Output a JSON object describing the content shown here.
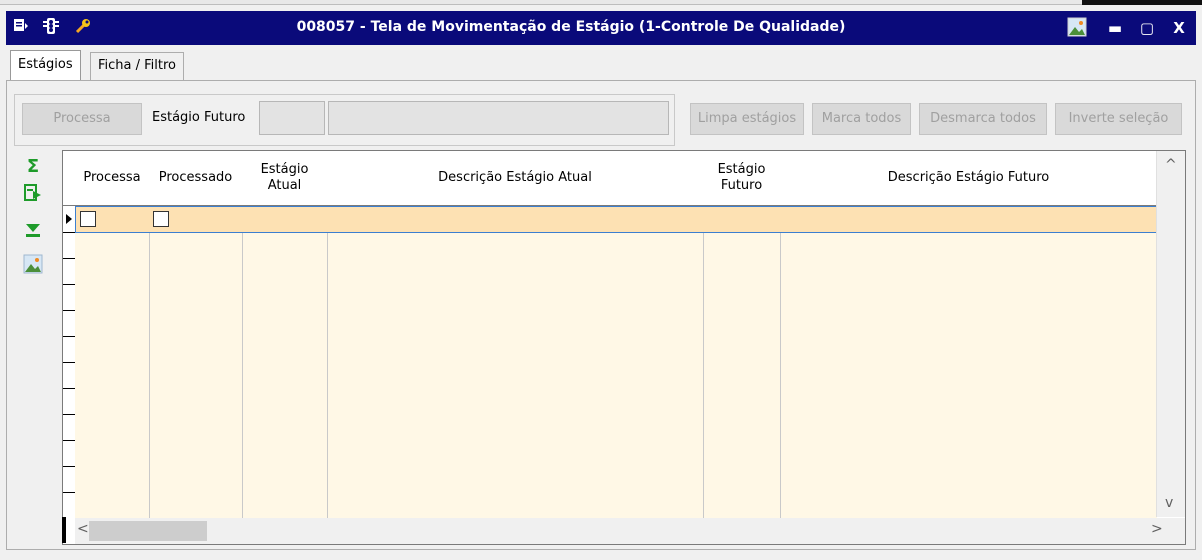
{
  "window": {
    "title": "008057 - Tela de Movimentação de Estágio (1-Controle De Qualidade)",
    "left_icons": [
      "list-icon",
      "traffic-light-icon",
      "wrench-icon"
    ],
    "right_icons": [
      "image-icon",
      "minimize-icon",
      "maximize-icon",
      "close-icon"
    ],
    "minimize_glyph": "▬",
    "maximize_glyph": "▢",
    "close_glyph": "X"
  },
  "tabs": [
    {
      "label": "Estágios",
      "active": true
    },
    {
      "label": "Ficha / Filtro",
      "active": false
    }
  ],
  "toolbar": {
    "processa_label": "Processa",
    "estagio_futuro_label": "Estágio Futuro",
    "estagio_futuro_code": "",
    "estagio_futuro_desc": "",
    "limpa_label": "Limpa estágios",
    "marca_label": "Marca todos",
    "desmarca_label": "Desmarca todos",
    "inverte_label": "Inverte seleção"
  },
  "side_icons": [
    "sum-icon",
    "export-icon",
    "download-icon",
    "image-icon"
  ],
  "grid": {
    "columns": [
      "Processa",
      "Processado",
      "Estágio\nAtual",
      "Descrição Estágio Atual",
      "Estágio\nFuturo",
      "Descrição Estágio Futuro"
    ],
    "rows": [
      {
        "processa": false,
        "processado": false,
        "estagio_atual": "",
        "descricao_atual": "",
        "estagio_futuro": "",
        "descricao_futuro": ""
      }
    ]
  },
  "colors": {
    "titlebar": "#0a0a7a",
    "row_selected": "#fde1b3",
    "grid_body": "#fff8e6"
  }
}
